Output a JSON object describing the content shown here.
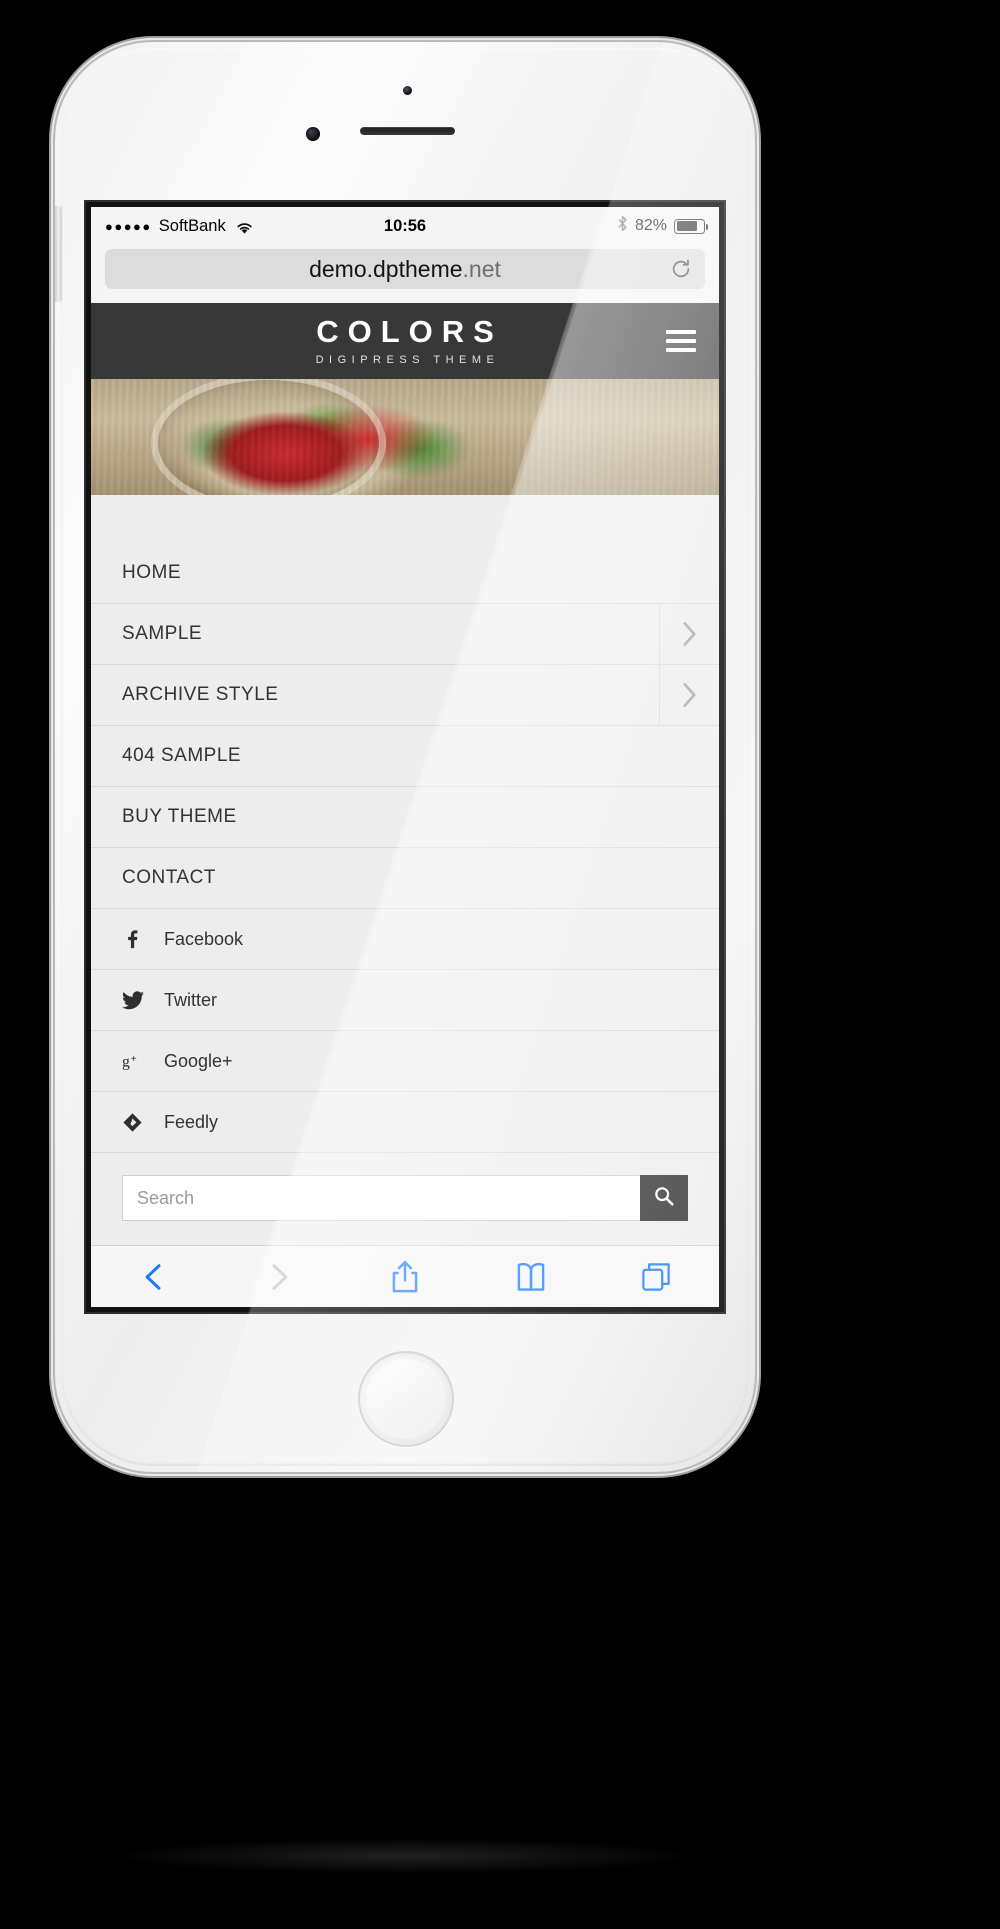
{
  "status_bar": {
    "signal_dots": "●●●●●",
    "carrier": "SoftBank",
    "wifi_icon": "wifi-icon",
    "time": "10:56",
    "bluetooth_icon": "bluetooth-icon",
    "battery_percent": "82%",
    "battery_level": 82
  },
  "browser": {
    "url_prefix": "demo.dptheme",
    "url_suffix": ".net",
    "url_full": "demo.dptheme.net",
    "reload_icon": "reload-icon"
  },
  "site_header": {
    "logo": "COLORS",
    "tagline": "DIGIPRESS THEME",
    "menu_icon": "hamburger-menu-icon",
    "background_color": "#383838"
  },
  "hero": {
    "alt": "bowl of chopped tomatoes and parsley on wooden table"
  },
  "nav": {
    "items": [
      {
        "label": "HOME",
        "has_submenu": false
      },
      {
        "label": "SAMPLE",
        "has_submenu": true
      },
      {
        "label": "ARCHIVE STYLE",
        "has_submenu": true
      },
      {
        "label": "404 SAMPLE",
        "has_submenu": false
      },
      {
        "label": "BUY THEME",
        "has_submenu": false
      },
      {
        "label": "CONTACT",
        "has_submenu": false
      }
    ]
  },
  "social": {
    "items": [
      {
        "label": "Facebook",
        "icon": "facebook-icon"
      },
      {
        "label": "Twitter",
        "icon": "twitter-icon"
      },
      {
        "label": "Google+",
        "icon": "google-plus-icon"
      },
      {
        "label": "Feedly",
        "icon": "feedly-icon"
      }
    ]
  },
  "search": {
    "placeholder": "Search",
    "value": "",
    "submit_icon": "search-icon",
    "button_color": "#2e2e2e"
  },
  "toolbar": {
    "items": [
      {
        "name": "back-button",
        "icon": "chevron-left-icon",
        "enabled": true
      },
      {
        "name": "forward-button",
        "icon": "chevron-right-icon",
        "enabled": false
      },
      {
        "name": "share-button",
        "icon": "share-icon",
        "enabled": true
      },
      {
        "name": "bookmarks-button",
        "icon": "book-icon",
        "enabled": true
      },
      {
        "name": "tabs-button",
        "icon": "tabs-icon",
        "enabled": true
      }
    ],
    "accent_color": "#1a7aff",
    "disabled_color": "#b6b6b6"
  }
}
